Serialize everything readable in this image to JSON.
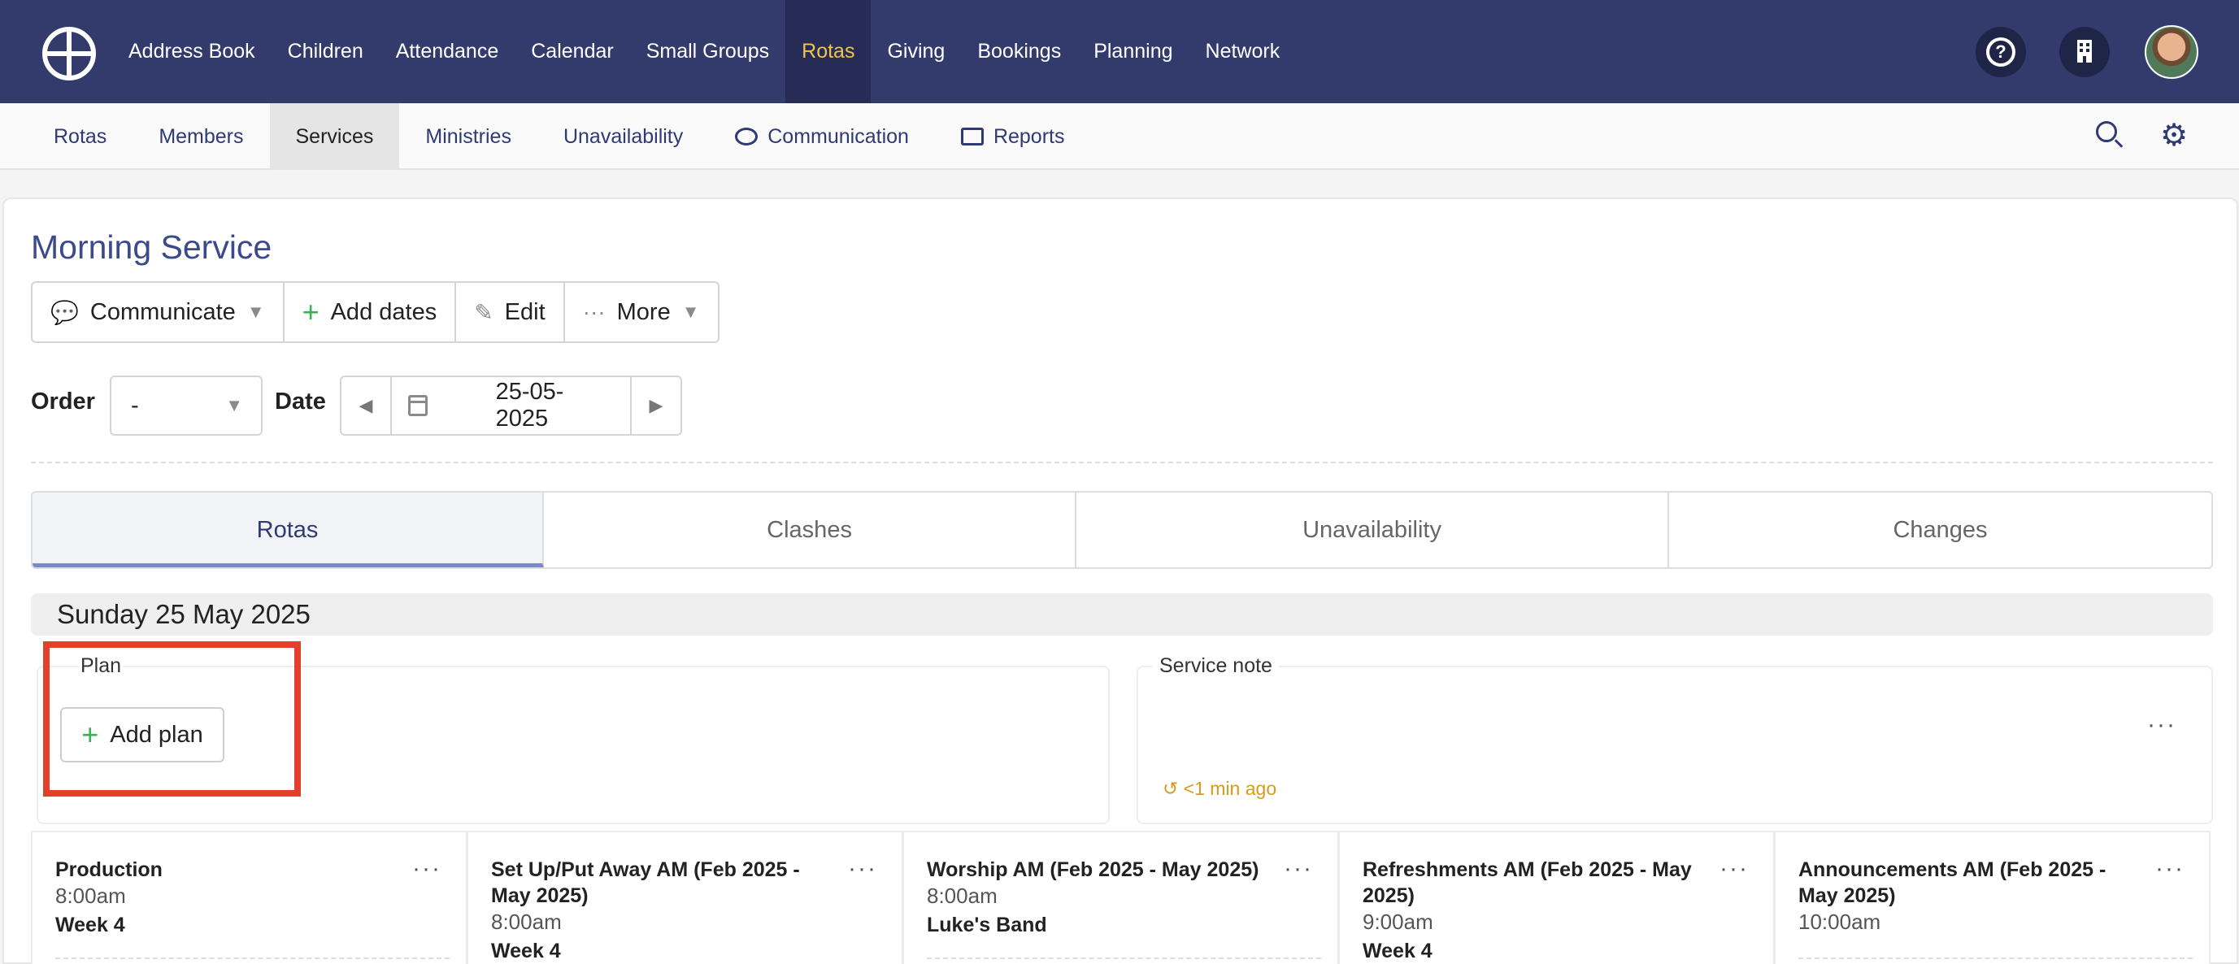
{
  "topnav": {
    "items": [
      "Address Book",
      "Children",
      "Attendance",
      "Calendar",
      "Small Groups",
      "Rotas",
      "Giving",
      "Bookings",
      "Planning",
      "Network"
    ],
    "active": "Rotas",
    "help_icon": "question-circle-icon",
    "org_icon": "building-icon"
  },
  "subnav": {
    "items": [
      "Rotas",
      "Members",
      "Services",
      "Ministries",
      "Unavailability",
      "Communication",
      "Reports"
    ],
    "active": "Services"
  },
  "page": {
    "title": "Morning Service",
    "toolbar": {
      "communicate": "Communicate",
      "add_dates": "Add dates",
      "edit": "Edit",
      "more": "More"
    },
    "order_label": "Order",
    "order_value": "-",
    "date_label": "Date",
    "date_value": "25-05-2025",
    "tabs": [
      "Rotas",
      "Clashes",
      "Unavailability",
      "Changes"
    ],
    "active_tab": "Rotas",
    "day_heading": "Sunday 25 May 2025",
    "plan_label": "Plan",
    "add_plan": "Add plan",
    "service_note_label": "Service note",
    "note_updated": "<1 min ago",
    "rotas": [
      {
        "title": "Production",
        "time": "8:00am",
        "sub": "Week 4"
      },
      {
        "title": "Set Up/Put Away AM (Feb 2025 - May 2025)",
        "time": "8:00am",
        "sub": "Week 4"
      },
      {
        "title": "Worship AM (Feb 2025 - May 2025)",
        "time": "8:00am",
        "sub": "Luke's Band"
      },
      {
        "title": "Refreshments AM (Feb 2025 - May 2025)",
        "time": "9:00am",
        "sub": "Week 4"
      },
      {
        "title": "Announcements AM (Feb 2025 - May 2025)",
        "time": "10:00am",
        "sub": ""
      }
    ]
  },
  "colors": {
    "nav_bg": "#333b6c",
    "nav_active_text": "#f2c34a",
    "link": "#2f3a74",
    "accent_green": "#3cb055",
    "highlight_red": "#e2402b",
    "timestamp": "#d99a1c"
  }
}
